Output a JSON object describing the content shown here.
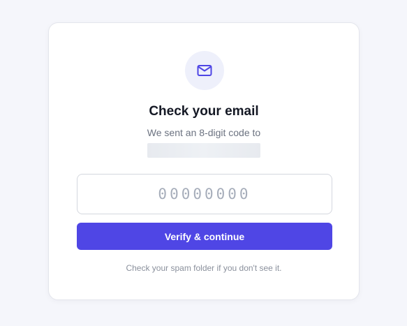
{
  "card": {
    "icon": "mail-icon",
    "title": "Check your email",
    "subtitle": "We sent an 8-digit code to",
    "code_input": {
      "value": "",
      "placeholder": "00000000"
    },
    "verify_button_label": "Verify & continue",
    "hint": "Check your spam folder if you don't see it."
  },
  "colors": {
    "accent": "#4f46e5",
    "icon_bg": "#eef0fb",
    "page_bg": "#f5f6fb"
  }
}
